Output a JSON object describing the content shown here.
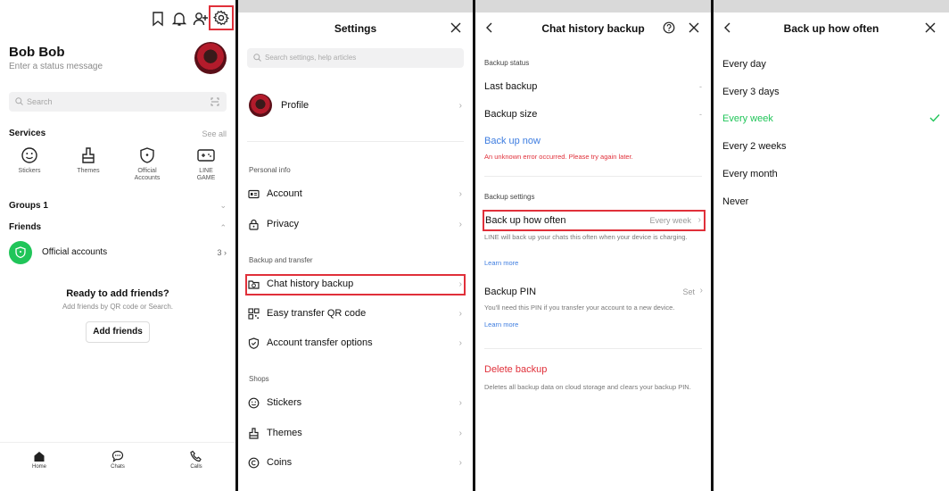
{
  "home": {
    "profile_name": "Bob Bob",
    "status_placeholder": "Enter a status message",
    "search_placeholder": "Search",
    "services_title": "Services",
    "see_all": "See all",
    "services": [
      {
        "label": "Stickers",
        "icon": "smiley-icon"
      },
      {
        "label": "Themes",
        "icon": "brush-icon"
      },
      {
        "label": "Official\nAccounts",
        "icon": "shield-icon"
      },
      {
        "label": "LINE\nGAME",
        "icon": "gamepad-icon"
      }
    ],
    "groups_label": "Groups 1",
    "friends_label": "Friends",
    "official_accounts_label": "Official accounts",
    "official_accounts_count": "3",
    "ready_title": "Ready to add friends?",
    "ready_sub": "Add friends by QR code or Search.",
    "add_friends_button": "Add friends",
    "tabs": [
      {
        "label": "Home",
        "icon": "home-icon"
      },
      {
        "label": "Chats",
        "icon": "chat-icon"
      },
      {
        "label": "Calls",
        "icon": "phone-icon"
      }
    ]
  },
  "settings": {
    "title": "Settings",
    "search_placeholder": "Search settings, help articles",
    "profile_label": "Profile",
    "groups": [
      {
        "label": "Personal info",
        "items": [
          "Account",
          "Privacy"
        ]
      },
      {
        "label": "Backup and transfer",
        "items": [
          "Chat history backup",
          "Easy transfer QR code",
          "Account transfer options"
        ]
      },
      {
        "label": "Shops",
        "items": [
          "Stickers",
          "Themes",
          "Coins"
        ]
      }
    ]
  },
  "backup": {
    "title": "Chat history backup",
    "backup_status_label": "Backup status",
    "last_backup_label": "Last backup",
    "last_backup_value": "-",
    "backup_size_label": "Backup size",
    "backup_size_value": "-",
    "back_up_now": "Back up now",
    "error": "An unknown error occurred. Please try again later.",
    "backup_settings_label": "Backup settings",
    "how_often_label": "Back up how often",
    "how_often_value": "Every week",
    "how_often_desc": "LINE will back up your chats this often when your device is charging.",
    "learn_more": "Learn more",
    "pin_label": "Backup PIN",
    "pin_value": "Set",
    "pin_desc": "You'll need this PIN if you transfer your account to a new device.",
    "learn_more_2": "Learn more",
    "delete_label": "Delete backup",
    "delete_desc": "Deletes all backup data on cloud storage and clears your backup PIN."
  },
  "frequency": {
    "title": "Back up how often",
    "options": [
      "Every day",
      "Every 3 days",
      "Every week",
      "Every 2 weeks",
      "Every month",
      "Never"
    ],
    "selected": "Every week",
    "accent_color": "#20c559"
  },
  "colors": {
    "highlight": "#e0303a",
    "link": "#3e7de0",
    "line_green": "#20c559"
  }
}
